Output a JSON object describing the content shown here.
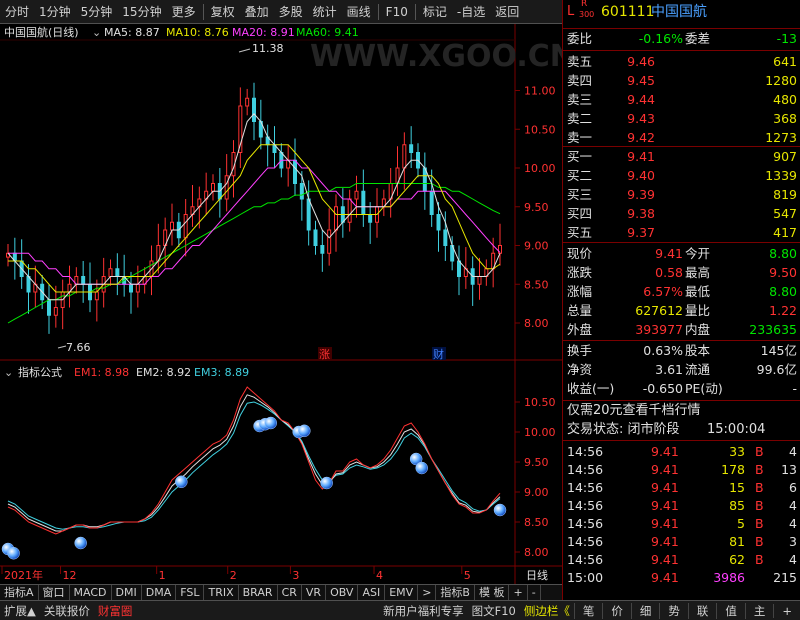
{
  "toolbar": {
    "items": [
      "分时",
      "1分钟",
      "5分钟",
      "15分钟",
      "更多",
      "复权",
      "叠加",
      "多股",
      "统计",
      "画线",
      "F10",
      "标记",
      "-自选",
      "返回"
    ]
  },
  "main_chart": {
    "title": "中国国航(日线)",
    "ma": [
      {
        "label": "MA5: 8.87",
        "color": "#e0e0e0"
      },
      {
        "label": "MA10: 8.76",
        "color": "#e6e600"
      },
      {
        "label": "MA20: 8.91",
        "color": "#ff40ff"
      },
      {
        "label": "MA60: 9.41",
        "color": "#00e600"
      }
    ],
    "high_label": "11.38",
    "low_label": "7.66",
    "y_ticks": [
      "11.00",
      "10.50",
      "10.00",
      "9.50",
      "9.00",
      "8.50",
      "8.00"
    ],
    "marker_zhang": "涨",
    "marker_cai": "财",
    "watermark": "WWW.XGOO.CN"
  },
  "sub_chart": {
    "title": "指标公式",
    "em": [
      {
        "label": "EM1: 8.98",
        "color": "#ff3232"
      },
      {
        "label": "EM2: 8.92",
        "color": "#e0e0e0"
      },
      {
        "label": "EM3: 8.89",
        "color": "#40d0e0"
      }
    ],
    "y_ticks": [
      "10.50",
      "10.00",
      "9.50",
      "9.00",
      "8.50",
      "8.00"
    ]
  },
  "x_axis": {
    "labels": [
      "2021年",
      "12",
      "1",
      "2",
      "3",
      "4",
      "5"
    ],
    "period": "日线"
  },
  "chart_data": {
    "type": "line",
    "main_ylim": [
      7.6,
      11.6
    ],
    "sub_ylim": [
      7.8,
      10.8
    ],
    "close": [
      8.9,
      8.8,
      8.6,
      8.4,
      8.5,
      8.3,
      8.1,
      8.2,
      8.4,
      8.5,
      8.6,
      8.5,
      8.3,
      8.4,
      8.6,
      8.7,
      8.6,
      8.5,
      8.4,
      8.5,
      8.6,
      8.8,
      9.0,
      9.2,
      9.3,
      9.1,
      9.4,
      9.5,
      9.6,
      9.7,
      9.8,
      9.6,
      9.9,
      10.2,
      10.8,
      10.9,
      10.6,
      10.4,
      10.3,
      10.2,
      10.0,
      10.1,
      9.8,
      9.6,
      9.2,
      9.0,
      8.9,
      9.2,
      9.5,
      9.3,
      9.6,
      9.7,
      9.4,
      9.3,
      9.5,
      9.6,
      9.8,
      10.0,
      10.3,
      10.2,
      10.0,
      9.7,
      9.4,
      9.2,
      9.0,
      8.8,
      8.6,
      8.7,
      8.5,
      8.6,
      8.7,
      8.9,
      9.0
    ],
    "ma5": [
      8.9,
      8.8,
      8.7,
      8.6,
      8.5,
      8.4,
      8.3,
      8.3,
      8.3,
      8.4,
      8.5,
      8.5,
      8.5,
      8.5,
      8.5,
      8.6,
      8.6,
      8.6,
      8.5,
      8.5,
      8.6,
      8.7,
      8.8,
      9.0,
      9.2,
      9.2,
      9.3,
      9.4,
      9.5,
      9.6,
      9.7,
      9.7,
      9.8,
      10.0,
      10.3,
      10.6,
      10.7,
      10.6,
      10.4,
      10.3,
      10.2,
      10.1,
      10.0,
      9.9,
      9.6,
      9.4,
      9.2,
      9.1,
      9.2,
      9.3,
      9.4,
      9.5,
      9.5,
      9.5,
      9.5,
      9.5,
      9.6,
      9.8,
      10.0,
      10.1,
      10.1,
      10.0,
      9.8,
      9.5,
      9.3,
      9.0,
      8.8,
      8.7,
      8.6,
      8.6,
      8.6,
      8.7,
      8.9
    ],
    "ma10": [
      8.8,
      8.8,
      8.8,
      8.7,
      8.7,
      8.6,
      8.5,
      8.4,
      8.4,
      8.4,
      8.4,
      8.4,
      8.4,
      8.4,
      8.5,
      8.5,
      8.5,
      8.6,
      8.6,
      8.6,
      8.6,
      8.6,
      8.7,
      8.8,
      8.9,
      9.0,
      9.1,
      9.2,
      9.3,
      9.4,
      9.5,
      9.6,
      9.7,
      9.8,
      9.9,
      10.1,
      10.2,
      10.3,
      10.3,
      10.3,
      10.3,
      10.3,
      10.2,
      10.1,
      10.0,
      9.8,
      9.6,
      9.5,
      9.4,
      9.4,
      9.4,
      9.4,
      9.4,
      9.4,
      9.4,
      9.5,
      9.5,
      9.6,
      9.7,
      9.8,
      9.9,
      9.9,
      9.9,
      9.8,
      9.6,
      9.5,
      9.3,
      9.1,
      8.9,
      8.8,
      8.7,
      8.7,
      8.76
    ],
    "ma20": [
      8.9,
      8.9,
      8.9,
      8.9,
      8.8,
      8.8,
      8.7,
      8.7,
      8.6,
      8.6,
      8.5,
      8.5,
      8.5,
      8.5,
      8.5,
      8.5,
      8.5,
      8.5,
      8.5,
      8.5,
      8.5,
      8.6,
      8.6,
      8.7,
      8.7,
      8.8,
      8.9,
      9.0,
      9.0,
      9.1,
      9.2,
      9.3,
      9.4,
      9.5,
      9.6,
      9.7,
      9.8,
      9.9,
      10.0,
      10.0,
      10.1,
      10.1,
      10.1,
      10.0,
      10.0,
      9.9,
      9.8,
      9.7,
      9.7,
      9.6,
      9.6,
      9.5,
      9.5,
      9.5,
      9.5,
      9.5,
      9.5,
      9.6,
      9.6,
      9.6,
      9.7,
      9.7,
      9.7,
      9.7,
      9.7,
      9.6,
      9.5,
      9.4,
      9.3,
      9.2,
      9.1,
      9.0,
      8.91
    ],
    "ma60": [
      8.0,
      8.05,
      8.1,
      8.15,
      8.2,
      8.25,
      8.3,
      8.3,
      8.35,
      8.35,
      8.4,
      8.4,
      8.4,
      8.45,
      8.45,
      8.5,
      8.5,
      8.55,
      8.6,
      8.65,
      8.7,
      8.75,
      8.8,
      8.85,
      8.9,
      8.95,
      9.0,
      9.05,
      9.1,
      9.15,
      9.2,
      9.25,
      9.3,
      9.35,
      9.4,
      9.45,
      9.5,
      9.5,
      9.55,
      9.55,
      9.6,
      9.6,
      9.65,
      9.65,
      9.7,
      9.7,
      9.7,
      9.7,
      9.75,
      9.75,
      9.75,
      9.8,
      9.8,
      9.8,
      9.8,
      9.8,
      9.8,
      9.8,
      9.8,
      9.8,
      9.8,
      9.8,
      9.8,
      9.75,
      9.75,
      9.7,
      9.7,
      9.65,
      9.6,
      9.55,
      9.5,
      9.45,
      9.41
    ],
    "em1": [
      8.75,
      8.7,
      8.6,
      8.5,
      8.45,
      8.4,
      8.35,
      8.3,
      8.35,
      8.4,
      8.45,
      8.45,
      8.4,
      8.4,
      8.45,
      8.5,
      8.5,
      8.5,
      8.5,
      8.5,
      8.55,
      8.65,
      8.8,
      9.0,
      9.2,
      9.3,
      9.4,
      9.5,
      9.6,
      9.7,
      9.8,
      9.85,
      9.95,
      10.2,
      10.55,
      10.75,
      10.65,
      10.55,
      10.45,
      10.35,
      10.2,
      10.15,
      10.0,
      9.8,
      9.5,
      9.2,
      9.05,
      9.15,
      9.35,
      9.35,
      9.5,
      9.55,
      9.45,
      9.4,
      9.45,
      9.55,
      9.7,
      9.9,
      10.1,
      10.15,
      10.0,
      9.8,
      9.55,
      9.35,
      9.15,
      8.95,
      8.8,
      8.75,
      8.65,
      8.65,
      8.7,
      8.85,
      8.98
    ],
    "em2": [
      8.8,
      8.75,
      8.65,
      8.55,
      8.5,
      8.45,
      8.4,
      8.35,
      8.35,
      8.4,
      8.45,
      8.45,
      8.42,
      8.42,
      8.45,
      8.5,
      8.5,
      8.5,
      8.5,
      8.5,
      8.55,
      8.62,
      8.75,
      8.92,
      9.1,
      9.2,
      9.3,
      9.42,
      9.52,
      9.62,
      9.72,
      9.78,
      9.88,
      10.1,
      10.42,
      10.62,
      10.58,
      10.5,
      10.42,
      10.32,
      10.2,
      10.12,
      10.0,
      9.82,
      9.55,
      9.3,
      9.12,
      9.15,
      9.3,
      9.32,
      9.45,
      9.5,
      9.45,
      9.4,
      9.42,
      9.5,
      9.62,
      9.8,
      10.0,
      10.05,
      9.95,
      9.78,
      9.55,
      9.35,
      9.15,
      8.98,
      8.82,
      8.78,
      8.68,
      8.66,
      8.7,
      8.82,
      8.92
    ],
    "em3": [
      8.85,
      8.8,
      8.7,
      8.6,
      8.55,
      8.5,
      8.45,
      8.4,
      8.38,
      8.4,
      8.42,
      8.42,
      8.4,
      8.4,
      8.42,
      8.45,
      8.48,
      8.5,
      8.5,
      8.5,
      8.52,
      8.58,
      8.7,
      8.85,
      9.0,
      9.1,
      9.2,
      9.32,
      9.42,
      9.52,
      9.62,
      9.7,
      9.8,
      9.98,
      10.28,
      10.48,
      10.5,
      10.45,
      10.38,
      10.3,
      10.2,
      10.1,
      10.0,
      9.85,
      9.6,
      9.38,
      9.2,
      9.18,
      9.28,
      9.3,
      9.4,
      9.45,
      9.42,
      9.38,
      9.4,
      9.45,
      9.55,
      9.7,
      9.9,
      9.98,
      9.9,
      9.75,
      9.55,
      9.38,
      9.2,
      9.02,
      8.88,
      8.82,
      8.72,
      8.68,
      8.7,
      8.8,
      8.89
    ],
    "bubbles": [
      [
        0,
        8.05
      ],
      [
        1,
        7.98
      ],
      [
        13,
        8.15
      ],
      [
        31,
        9.17
      ],
      [
        45,
        10.1
      ],
      [
        46,
        10.13
      ],
      [
        47,
        10.15
      ],
      [
        52,
        10.0
      ],
      [
        53,
        10.02
      ],
      [
        57,
        9.15
      ],
      [
        73,
        9.55
      ],
      [
        74,
        9.4
      ],
      [
        88,
        8.7
      ]
    ]
  },
  "panel": {
    "mark_l": "L",
    "mark_r": "R",
    "mark_300": "300",
    "code": "601111",
    "name": "中国国航",
    "weibi_label": "委比",
    "weibi": "-0.16%",
    "weicha_label": "委差",
    "weicha": "-13",
    "asks": [
      {
        "label": "卖五",
        "price": "9.46",
        "vol": "641"
      },
      {
        "label": "卖四",
        "price": "9.45",
        "vol": "1280"
      },
      {
        "label": "卖三",
        "price": "9.44",
        "vol": "480"
      },
      {
        "label": "卖二",
        "price": "9.43",
        "vol": "368"
      },
      {
        "label": "卖一",
        "price": "9.42",
        "vol": "1273"
      }
    ],
    "bids": [
      {
        "label": "买一",
        "price": "9.41",
        "vol": "907"
      },
      {
        "label": "买二",
        "price": "9.40",
        "vol": "1339"
      },
      {
        "label": "买三",
        "price": "9.39",
        "vol": "819"
      },
      {
        "label": "买四",
        "price": "9.38",
        "vol": "547"
      },
      {
        "label": "买五",
        "price": "9.37",
        "vol": "417"
      }
    ],
    "stats": [
      {
        "l1": "现价",
        "v1": "9.41",
        "c1": "red",
        "l2": "今开",
        "v2": "8.80",
        "c2": "green"
      },
      {
        "l1": "涨跌",
        "v1": "0.58",
        "c1": "red",
        "l2": "最高",
        "v2": "9.50",
        "c2": "red"
      },
      {
        "l1": "涨幅",
        "v1": "6.57%",
        "c1": "red",
        "l2": "最低",
        "v2": "8.80",
        "c2": "green"
      },
      {
        "l1": "总量",
        "v1": "627612",
        "c1": "yellow",
        "l2": "量比",
        "v2": "1.22",
        "c2": "red"
      },
      {
        "l1": "外盘",
        "v1": "393977",
        "c1": "red",
        "l2": "内盘",
        "v2": "233635",
        "c2": "green"
      }
    ],
    "stats2": [
      {
        "l1": "换手",
        "v1": "0.63%",
        "l2": "股本",
        "v2": "145亿"
      },
      {
        "l1": "净资",
        "v1": "3.61",
        "l2": "流通",
        "v2": "99.6亿"
      },
      {
        "l1": "收益(一)",
        "v1": "-0.650",
        "l2": "PE(动)",
        "v2": "-"
      }
    ],
    "promo": "仅需20元查看千档行情",
    "status_label": "交易状态: 闭市阶段",
    "status_time": "15:00:04",
    "ticks": [
      {
        "time": "14:56",
        "price": "9.41",
        "vol": "33",
        "side": "B",
        "n": "4"
      },
      {
        "time": "14:56",
        "price": "9.41",
        "vol": "178",
        "side": "B",
        "n": "13"
      },
      {
        "time": "14:56",
        "price": "9.41",
        "vol": "15",
        "side": "B",
        "n": "6"
      },
      {
        "time": "14:56",
        "price": "9.41",
        "vol": "85",
        "side": "B",
        "n": "4"
      },
      {
        "time": "14:56",
        "price": "9.41",
        "vol": "5",
        "side": "B",
        "n": "4"
      },
      {
        "time": "14:56",
        "price": "9.41",
        "vol": "81",
        "side": "B",
        "n": "3"
      },
      {
        "time": "14:56",
        "price": "9.41",
        "vol": "62",
        "side": "B",
        "n": "4"
      },
      {
        "time": "15:00",
        "price": "9.41",
        "vol": "3986",
        "side": "",
        "n": "215"
      }
    ]
  },
  "tabs_row1": [
    "指标A",
    "窗口",
    "MACD",
    "DMI",
    "DMA",
    "FSL",
    "TRIX",
    "BRAR",
    "CR",
    "VR",
    "OBV",
    "ASI",
    "EMV",
    ">",
    "指标B",
    "模 板",
    "+",
    "-"
  ],
  "tabs_row2_left": [
    "扩展▲",
    "关联报价",
    "财富圈"
  ],
  "tabs_row2_mid": [
    "新用户福利专享",
    "图文F10",
    "侧边栏《"
  ],
  "tabs_row2_right": [
    "笔",
    "价",
    "细",
    "势",
    "联",
    "值",
    "主",
    "+"
  ]
}
